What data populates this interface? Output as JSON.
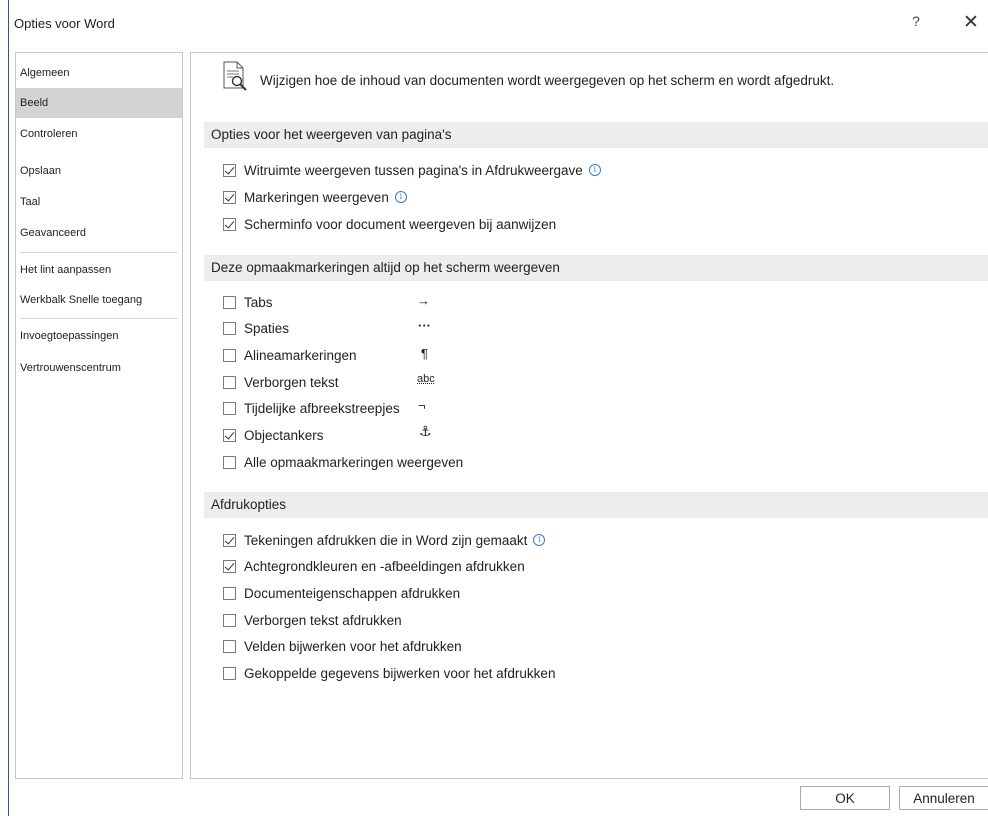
{
  "window": {
    "title": "Opties voor Word",
    "help": "?",
    "close": "✕"
  },
  "sidebar": {
    "items": [
      {
        "label": "Algemeen"
      },
      {
        "label": "Beeld"
      },
      {
        "label": "Controleren"
      },
      {
        "label": "Opslaan"
      },
      {
        "label": "Taal"
      },
      {
        "label": "Geavanceerd"
      },
      {
        "label": "Het lint aanpassen"
      },
      {
        "label": "Werkbalk Snelle toegang"
      },
      {
        "label": "Invoegtoepassingen"
      },
      {
        "label": "Vertrouwenscentrum"
      }
    ]
  },
  "header": {
    "text": "Wijzigen hoe de inhoud van documenten wordt weergegeven op het scherm en wordt afgedrukt."
  },
  "sections": {
    "pages": {
      "title": "Opties voor het weergeven van pagina's",
      "items": [
        {
          "label": "Witruimte weergeven tussen pagina's in Afdrukweergave",
          "checked": true
        },
        {
          "label": "Markeringen weergeven",
          "checked": true
        },
        {
          "label": "Scherminfo voor document weergeven bij aanwijzen",
          "checked": true
        }
      ]
    },
    "marks": {
      "title": "Deze opmaakmarkeringen altijd op het scherm weergeven",
      "items": [
        {
          "label": "Tabs",
          "symbol": "→",
          "checked": false
        },
        {
          "label": "Spaties",
          "symbol": "···",
          "checked": false
        },
        {
          "label": "Alineamarkeringen",
          "symbol": "¶",
          "checked": false
        },
        {
          "label": "Verborgen tekst",
          "symbol": "abc",
          "checked": false
        },
        {
          "label": "Tijdelijke afbreekstreepjes",
          "symbol": "¬",
          "checked": false
        },
        {
          "label": "Objectankers",
          "symbol": "⚓",
          "checked": true
        },
        {
          "label": "Alle opmaakmarkeringen weergeven",
          "checked": false
        }
      ]
    },
    "print": {
      "title": "Afdrukopties",
      "items": [
        {
          "label": "Tekeningen afdrukken die in Word zijn gemaakt",
          "checked": true
        },
        {
          "label": "Achtegrondkleuren en -afbeeldingen afdrukken",
          "checked": true
        },
        {
          "label": "Documenteigenschappen afdrukken",
          "checked": false
        },
        {
          "label": "Verborgen tekst afdrukken",
          "checked": false
        },
        {
          "label": "Velden bijwerken voor het afdrukken",
          "checked": false
        },
        {
          "label": "Gekoppelde gegevens bijwerken voor het afdrukken",
          "checked": false
        }
      ]
    }
  },
  "footer": {
    "ok_label": "OK",
    "cancel_label": "Annuleren"
  },
  "icons": {
    "info": "info-icon",
    "help": "help-icon",
    "close": "close-icon",
    "header": "document-magnifier-icon"
  },
  "colors": {
    "accent": "#2b5797",
    "info": "#3a78d4",
    "active_nav": "#d3d3d3",
    "section_bg": "#ededed"
  }
}
